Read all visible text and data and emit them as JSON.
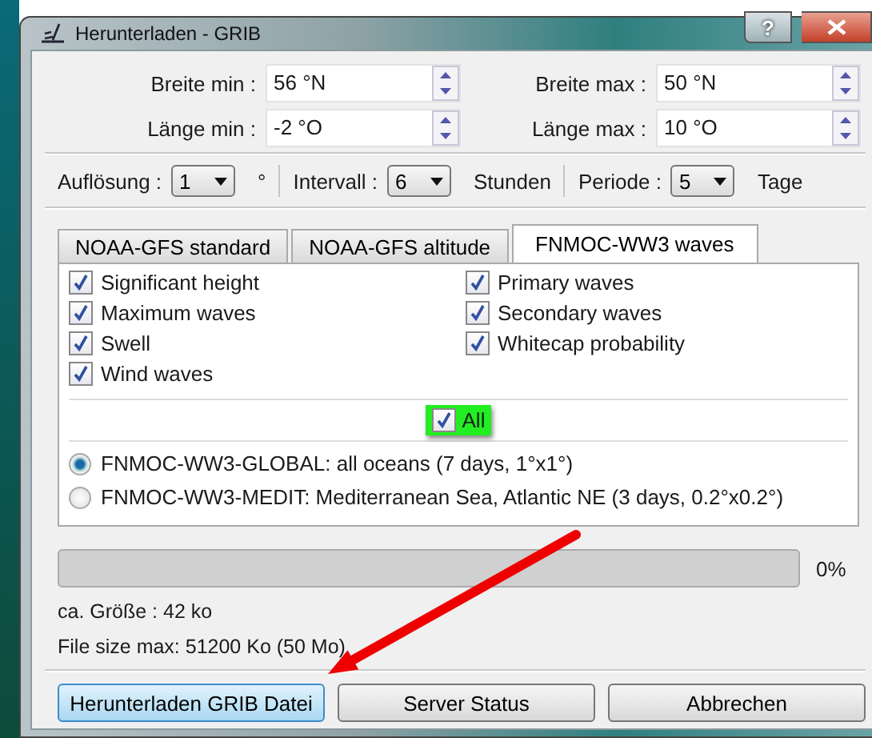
{
  "window": {
    "title": "Herunterladen - GRIB",
    "help": "?"
  },
  "coordinates": [
    {
      "label": "Breite min :",
      "value": "56 °N"
    },
    {
      "label": "Breite max :",
      "value": "50 °N"
    },
    {
      "label": "Länge min :",
      "value": "-2 °O"
    },
    {
      "label": "Länge max :",
      "value": "10 °O"
    }
  ],
  "settings": [
    {
      "label": "Auflösung :",
      "value": "1",
      "unit": "°"
    },
    {
      "label": "Intervall :",
      "value": "6",
      "unit": "Stunden"
    },
    {
      "label": "Periode :",
      "value": "5",
      "unit": "Tage"
    }
  ],
  "tabs": [
    {
      "label": "NOAA-GFS standard",
      "selected": false
    },
    {
      "label": "NOAA-GFS altitude",
      "selected": false
    },
    {
      "label": "FNMOC-WW3 waves",
      "selected": true
    }
  ],
  "parameters": [
    {
      "label": "Significant height",
      "checked": true
    },
    {
      "label": "Primary waves",
      "checked": true
    },
    {
      "label": "Maximum waves",
      "checked": true
    },
    {
      "label": "Secondary waves",
      "checked": true
    },
    {
      "label": "Swell",
      "checked": true
    },
    {
      "label": "Whitecap probability",
      "checked": true
    },
    {
      "label": "Wind waves",
      "checked": true
    }
  ],
  "all_checkbox": {
    "label": "All",
    "checked": true
  },
  "models": [
    {
      "label": "FNMOC-WW3-GLOBAL: all oceans (7 days, 1°x1°)",
      "selected": true
    },
    {
      "label": "FNMOC-WW3-MEDIT: Mediterranean Sea, Atlantic NE (3 days, 0.2°x0.2°)",
      "selected": false
    }
  ],
  "progress": {
    "level": 0,
    "reading": "0%"
  },
  "info": [
    "ca. Größe : 42 ko",
    "File size max: 51200 Ko (50 Mo)"
  ],
  "buttons": [
    {
      "label": "Herunterladen GRIB Datei",
      "focused": true
    },
    {
      "label": "Server Status",
      "focused": false
    },
    {
      "label": "Abbrechen",
      "focused": false
    }
  ]
}
